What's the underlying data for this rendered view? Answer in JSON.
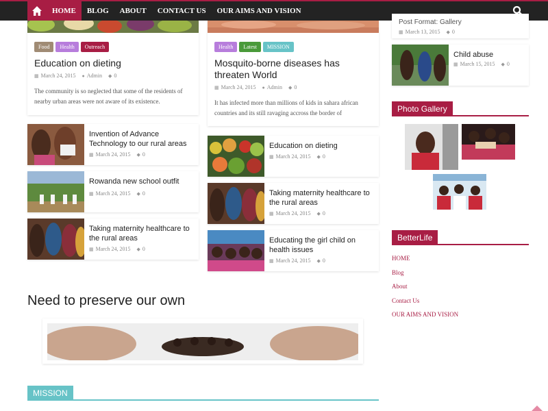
{
  "nav": {
    "items": [
      {
        "label": "HOME",
        "active": true
      },
      {
        "label": "BLOG",
        "active": false
      },
      {
        "label": "ABOUT",
        "active": false
      },
      {
        "label": "CONTACT US",
        "active": false
      },
      {
        "label": "OUR AIMS AND VISION",
        "active": false
      }
    ],
    "icons": [
      "home-icon",
      "search-icon"
    ]
  },
  "colors": {
    "brand": "#a81d44",
    "teal": "#67c3c7",
    "nav_bg": "#232323"
  },
  "featured": [
    {
      "categories": [
        {
          "label": "Food",
          "color": "#a08b74"
        },
        {
          "label": "Health",
          "color": "#b77ddc"
        },
        {
          "label": "Outreach",
          "color": "#a81d44"
        }
      ],
      "title": "Education on dieting",
      "date": "March 24, 2015",
      "author": "Admin",
      "comments": "0",
      "excerpt": "The community is so neglected that some of the residents of nearby urban areas were not aware of its existence."
    },
    {
      "categories": [
        {
          "label": "Health",
          "color": "#b77ddc"
        },
        {
          "label": "Latest",
          "color": "#4a9a3a"
        },
        {
          "label": "MISSION",
          "color": "#67c3c7"
        }
      ],
      "title": "Mosquito-borne diseases has threaten World",
      "date": "March 24, 2015",
      "author": "Admin",
      "comments": "0",
      "excerpt": "It has infected more than millions of kids in sahara african countries and its still ravaging accross the border of"
    }
  ],
  "left_list": [
    {
      "title": "Invention of Advance Technology to our rural areas",
      "date": "March 24, 2015",
      "comments": "0"
    },
    {
      "title": "Rowanda new school outfit",
      "date": "March 24, 2015",
      "comments": "0"
    },
    {
      "title": "Taking maternity healthcare to the rural areas",
      "date": "March 24, 2015",
      "comments": "0"
    }
  ],
  "right_list": [
    {
      "title": "Education on dieting",
      "date": "March 24, 2015",
      "comments": "0"
    },
    {
      "title": "Taking maternity healthcare to the rural areas",
      "date": "March 24, 2015",
      "comments": "0"
    },
    {
      "title": "Educating the girl child on health issues",
      "date": "March 24, 2015",
      "comments": "0"
    }
  ],
  "sidebar": {
    "posts": [
      {
        "title": "Post Format: Gallery",
        "date": "March 13, 2015",
        "comments": "0"
      },
      {
        "title": "Child abuse",
        "date": "March 15, 2015",
        "comments": "0"
      }
    ],
    "gallery_title": "Photo Gallery",
    "betterlife_title": "BetterLife",
    "links": [
      "HOME",
      "Blog",
      "About",
      "Contact Us",
      "OUR AIMS AND VISION"
    ]
  },
  "section": {
    "title": "Need to preserve our own",
    "mission_label": "MISSION"
  }
}
